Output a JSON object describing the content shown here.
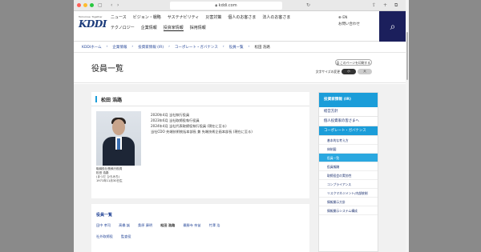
{
  "browser": {
    "url": "kddi.com"
  },
  "header": {
    "logo_tagline": "Tomorrow, Together",
    "logo_text": "KDDI",
    "nav_row1": [
      "ニュース",
      "ビジョン・戦略",
      "サステナビリティ",
      "災害対策",
      "個人のお客さま",
      "法人のお客さま"
    ],
    "nav_row2": [
      "テクノロジー",
      "企業情報",
      "投資家情報",
      "採用情報"
    ],
    "lang": "EN",
    "contact": "お問い合わせ"
  },
  "breadcrumb": [
    "KDDIホーム",
    "企業情報",
    "投資家情報 (IR)",
    "コーポレート・ガバナンス",
    "役員一覧",
    "松田 浩路"
  ],
  "page": {
    "title": "役員一覧",
    "print_label": "このページを印刷する",
    "font_size_label": "文字サイズの変更",
    "font_small": "小",
    "font_large": "大"
  },
  "profile": {
    "name": "松田 浩路",
    "history": [
      "2020年4月 当社執行役員",
      "2023年6月 当社取締役執行役員",
      "2024年4月 当社代表取締役執行役員 (現在に至る)",
      "当社CDO 先端技術統括本部長 兼 先端技術企画本部長 (現在に至る)"
    ],
    "caption": [
      "取締役社長執行役員",
      "松田 浩路",
      "(まつだ ひろみち)",
      "1971年11月30日生"
    ]
  },
  "officers": {
    "heading": "役員一覧",
    "row1": [
      "田中 孝司",
      "髙橋 誠",
      "桑原 康明",
      "松田 浩路",
      "最勝寺 奈苗",
      "竹澤 浩"
    ],
    "row2": [
      "社外取締役",
      "監査役"
    ],
    "current": "松田 浩路"
  },
  "sidebar": {
    "header": "投資家情報 (IR)",
    "items": [
      "経営方針",
      "個人投資家の皆さまへ",
      "コーポレート・ガバナンス"
    ],
    "subitems": [
      "基本的な考え方",
      "体制図",
      "役員一覧",
      "役員報酬",
      "取締役会の実効性",
      "コンプライアンス",
      "リスクマネジメント/内部統制",
      "情報開示方針",
      "情報開示システム構成"
    ],
    "selected_item": "コーポレート・ガバナンス",
    "selected_sub": "役員一覧"
  }
}
